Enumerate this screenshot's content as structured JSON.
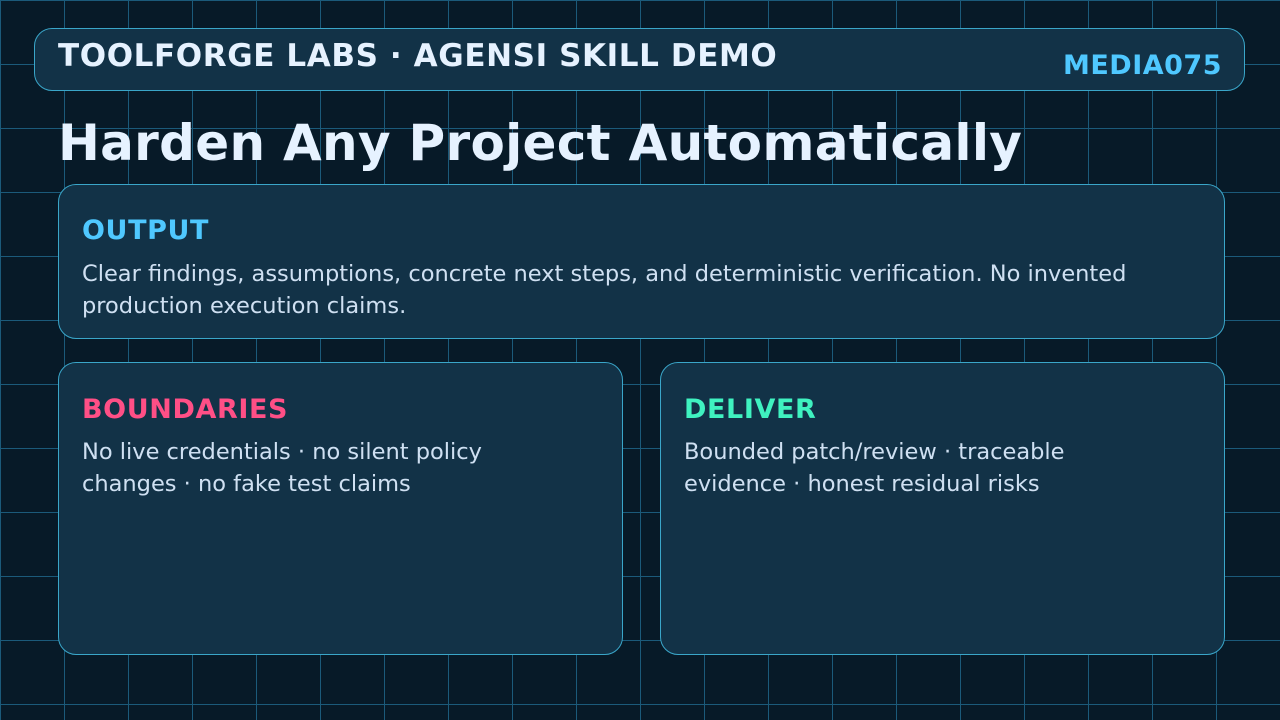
{
  "header": {
    "title": "TOOLFORGE LABS · AGENSI SKILL DEMO",
    "code": "MEDIA075"
  },
  "page_title": "Harden Any Project Automatically",
  "cards": {
    "output": {
      "heading": "OUTPUT",
      "heading_color": "#4fc8ff",
      "body": "Clear findings, assumptions, concrete next steps, and deterministic verification. No invented production execution claims."
    },
    "boundaries": {
      "heading": "BOUNDARIES",
      "heading_color": "#ff4f86",
      "body": "No live credentials · no silent policy changes · no fake test claims"
    },
    "deliver": {
      "heading": "DELIVER",
      "heading_color": "#3ff2c0",
      "body": "Bounded patch/review · traceable evidence · honest residual risks"
    }
  },
  "colors": {
    "background": "#071a28",
    "grid": "#1b5a7a",
    "panel": "#123247",
    "border": "#3aa6c9",
    "title_text": "#e6f2ff",
    "body_text": "#cfe0f2"
  }
}
